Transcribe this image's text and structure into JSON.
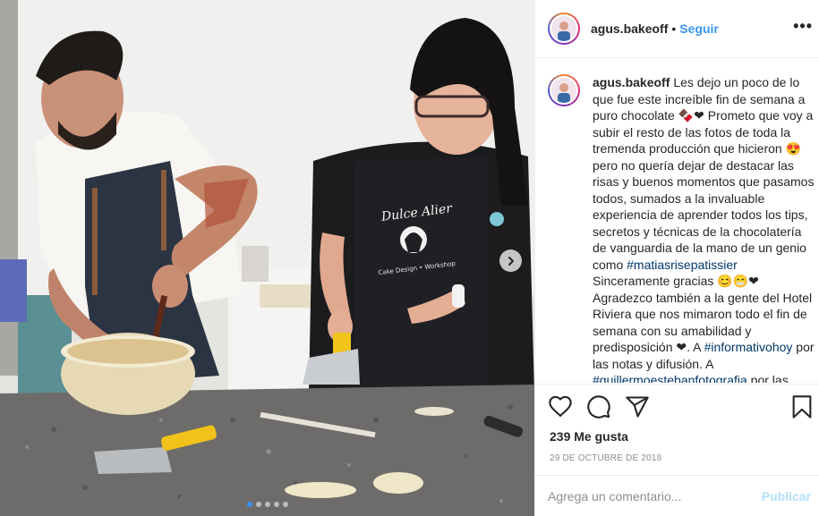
{
  "header": {
    "username": "agus.bakeoff",
    "separator": "•",
    "follow_label": "Seguir",
    "more_label": "•••"
  },
  "caption": {
    "author": "agus.bakeoff",
    "p1": "Les dejo un poco de lo que fue este increíble fin de semana a puro chocolate 🍫❤ Prometo que voy a subir el resto de las fotos de toda la tremenda producción que hicieron 😍 pero no quería dejar de destacar las risas y buenos momentos que pasamos todos, sumados a la invaluable experiencia de aprender todos los tips, secretos y técnicas de la chocolatería de vanguardia de la mano de un genio como ",
    "tag1": "#matiasrisepatissier",
    "p2": "Sinceramente gracias 😊😁❤",
    "p3": "Agradezco también a la gente del Hotel Riviera que nos mimaron todo el fin de semana con su amabilidad y predisposición ❤. A ",
    "tag2": "#informativohoy",
    "p4": " por las notas y difusión. A ",
    "tag3": "#guillermoestebanfotografia",
    "p5": " por las"
  },
  "photo": {
    "apron_text_1": "Dulce Alier",
    "apron_text_2": "Cake Design • Workshop"
  },
  "actions": {
    "likes": "239 Me gusta",
    "date": "29 DE OCTUBRE DE 2018"
  },
  "comment": {
    "placeholder": "Agrega un comentario...",
    "publish_label": "Publicar"
  },
  "icons": {
    "like": "heart-icon",
    "comment": "comment-icon",
    "share": "paper-plane-icon",
    "save": "bookmark-icon",
    "next": "chevron-right-icon"
  },
  "colors": {
    "link": "#3897f0",
    "hashtag": "#00376b",
    "muted": "#8e8e8e",
    "publish_disabled": "#b2dffc"
  },
  "carousel": {
    "count": 5,
    "active_index": 0
  }
}
